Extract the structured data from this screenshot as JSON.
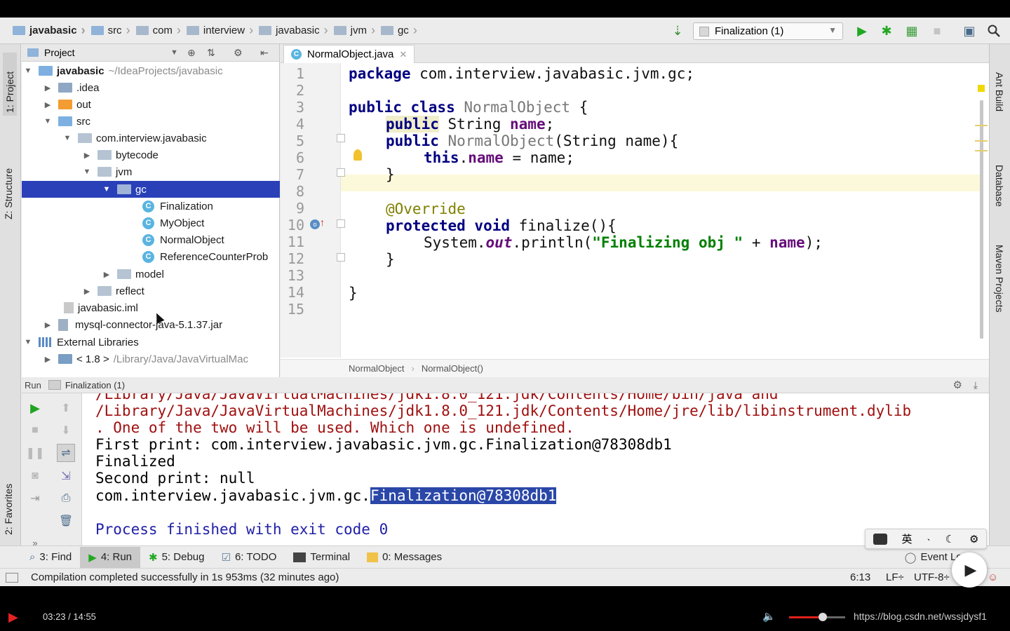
{
  "breadcrumb": [
    "javabasic",
    "src",
    "com",
    "interview",
    "javabasic",
    "jvm",
    "gc"
  ],
  "toolbar": {
    "run_config": "Finalization (1)"
  },
  "left_tabs": {
    "project": "1: Project",
    "structure": "Z: Structure",
    "favorites": "2: Favorites"
  },
  "right_tabs": {
    "ant": "Ant Build",
    "database": "Database",
    "maven": "Maven Projects"
  },
  "project": {
    "header": "Project",
    "rows": [
      {
        "label": "javabasic",
        "dim": "~/IdeaProjects/javabasic"
      },
      {
        "label": ".idea"
      },
      {
        "label": "out"
      },
      {
        "label": "src"
      },
      {
        "label": "com.interview.javabasic"
      },
      {
        "label": "bytecode"
      },
      {
        "label": "jvm"
      },
      {
        "label": "gc"
      },
      {
        "label": "Finalization"
      },
      {
        "label": "MyObject"
      },
      {
        "label": "NormalObject"
      },
      {
        "label": "ReferenceCounterProb"
      },
      {
        "label": "model"
      },
      {
        "label": "reflect"
      },
      {
        "label": "javabasic.iml"
      },
      {
        "label": "mysql-connector-java-5.1.37.jar"
      },
      {
        "label": "External Libraries"
      },
      {
        "label": "< 1.8 >",
        "dim": "/Library/Java/JavaVirtualMac"
      }
    ]
  },
  "editor": {
    "tab": "NormalObject.java",
    "line_numbers": [
      "1",
      "2",
      "3",
      "4",
      "5",
      "6",
      "7",
      "8",
      "9",
      "10",
      "11",
      "12",
      "13",
      "14",
      "15"
    ],
    "l1_kw": "package",
    "l1_rest": " com.interview.javabasic.jvm.gc;",
    "l3_kw": "public class",
    "l3_name": " NormalObject",
    "l3_rest": " {",
    "l4_kw": "public",
    "l4_type": " String ",
    "l4_fld": "name",
    "l4_end": ";",
    "l5_kw": "public",
    "l5_name": " NormalObject",
    "l5_rest": "(String name){",
    "l6_kw": "this",
    "l6_dot": ".",
    "l6_fld": "name",
    "l6_rest": " = name;",
    "l7": "}",
    "l9": "@Override",
    "l10_kw": "protected void",
    "l10_rest": " finalize(){",
    "l11_a": "System.",
    "l11_out": "out",
    "l11_b": ".println(",
    "l11_str": "\"Finalizing obj \"",
    "l11_c": " + ",
    "l11_fld": "name",
    "l11_d": ");",
    "l12": "}",
    "l14": "}",
    "crumb1": "NormalObject",
    "crumb2": "NormalObject()"
  },
  "run": {
    "label": "Run",
    "config": "Finalization (1)",
    "lines": {
      "e0": "/Library/Java/JavaVirtualMachines/jdk1.8.0_121.jdk/Contents/Home/bin/java and",
      "e1": "/Library/Java/JavaVirtualMachines/jdk1.8.0_121.jdk/Contents/Home/jre/lib/libinstrument.dylib",
      "e2": ". One of the two will be used. Which one is undefined.",
      "o1": "First print: com.interview.javabasic.jvm.gc.Finalization@78308db1",
      "o2": "Finalized",
      "o3": "Second print: null",
      "o4a": "com.interview.javabasic.jvm.gc.",
      "o4b": "Finalization@78308db1",
      "p": "Process finished with exit code 0"
    }
  },
  "bottom_tabs": {
    "find": "3: Find",
    "run": "4: Run",
    "debug": "5: Debug",
    "todo": "6: TODO",
    "terminal": "Terminal",
    "messages": "0: Messages",
    "event": "Event Log"
  },
  "status": {
    "message": "Compilation completed successfully in 1s 953ms (32 minutes ago)",
    "pos": "6:13",
    "lf": "LF÷",
    "enc": "UTF-8÷"
  },
  "ime": {
    "lang": "英"
  },
  "player": {
    "time": "03:23 / 14:55",
    "watermark": "https://blog.csdn.net/wssjdysf1",
    "progress": 0.23,
    "volume": 0.6
  }
}
